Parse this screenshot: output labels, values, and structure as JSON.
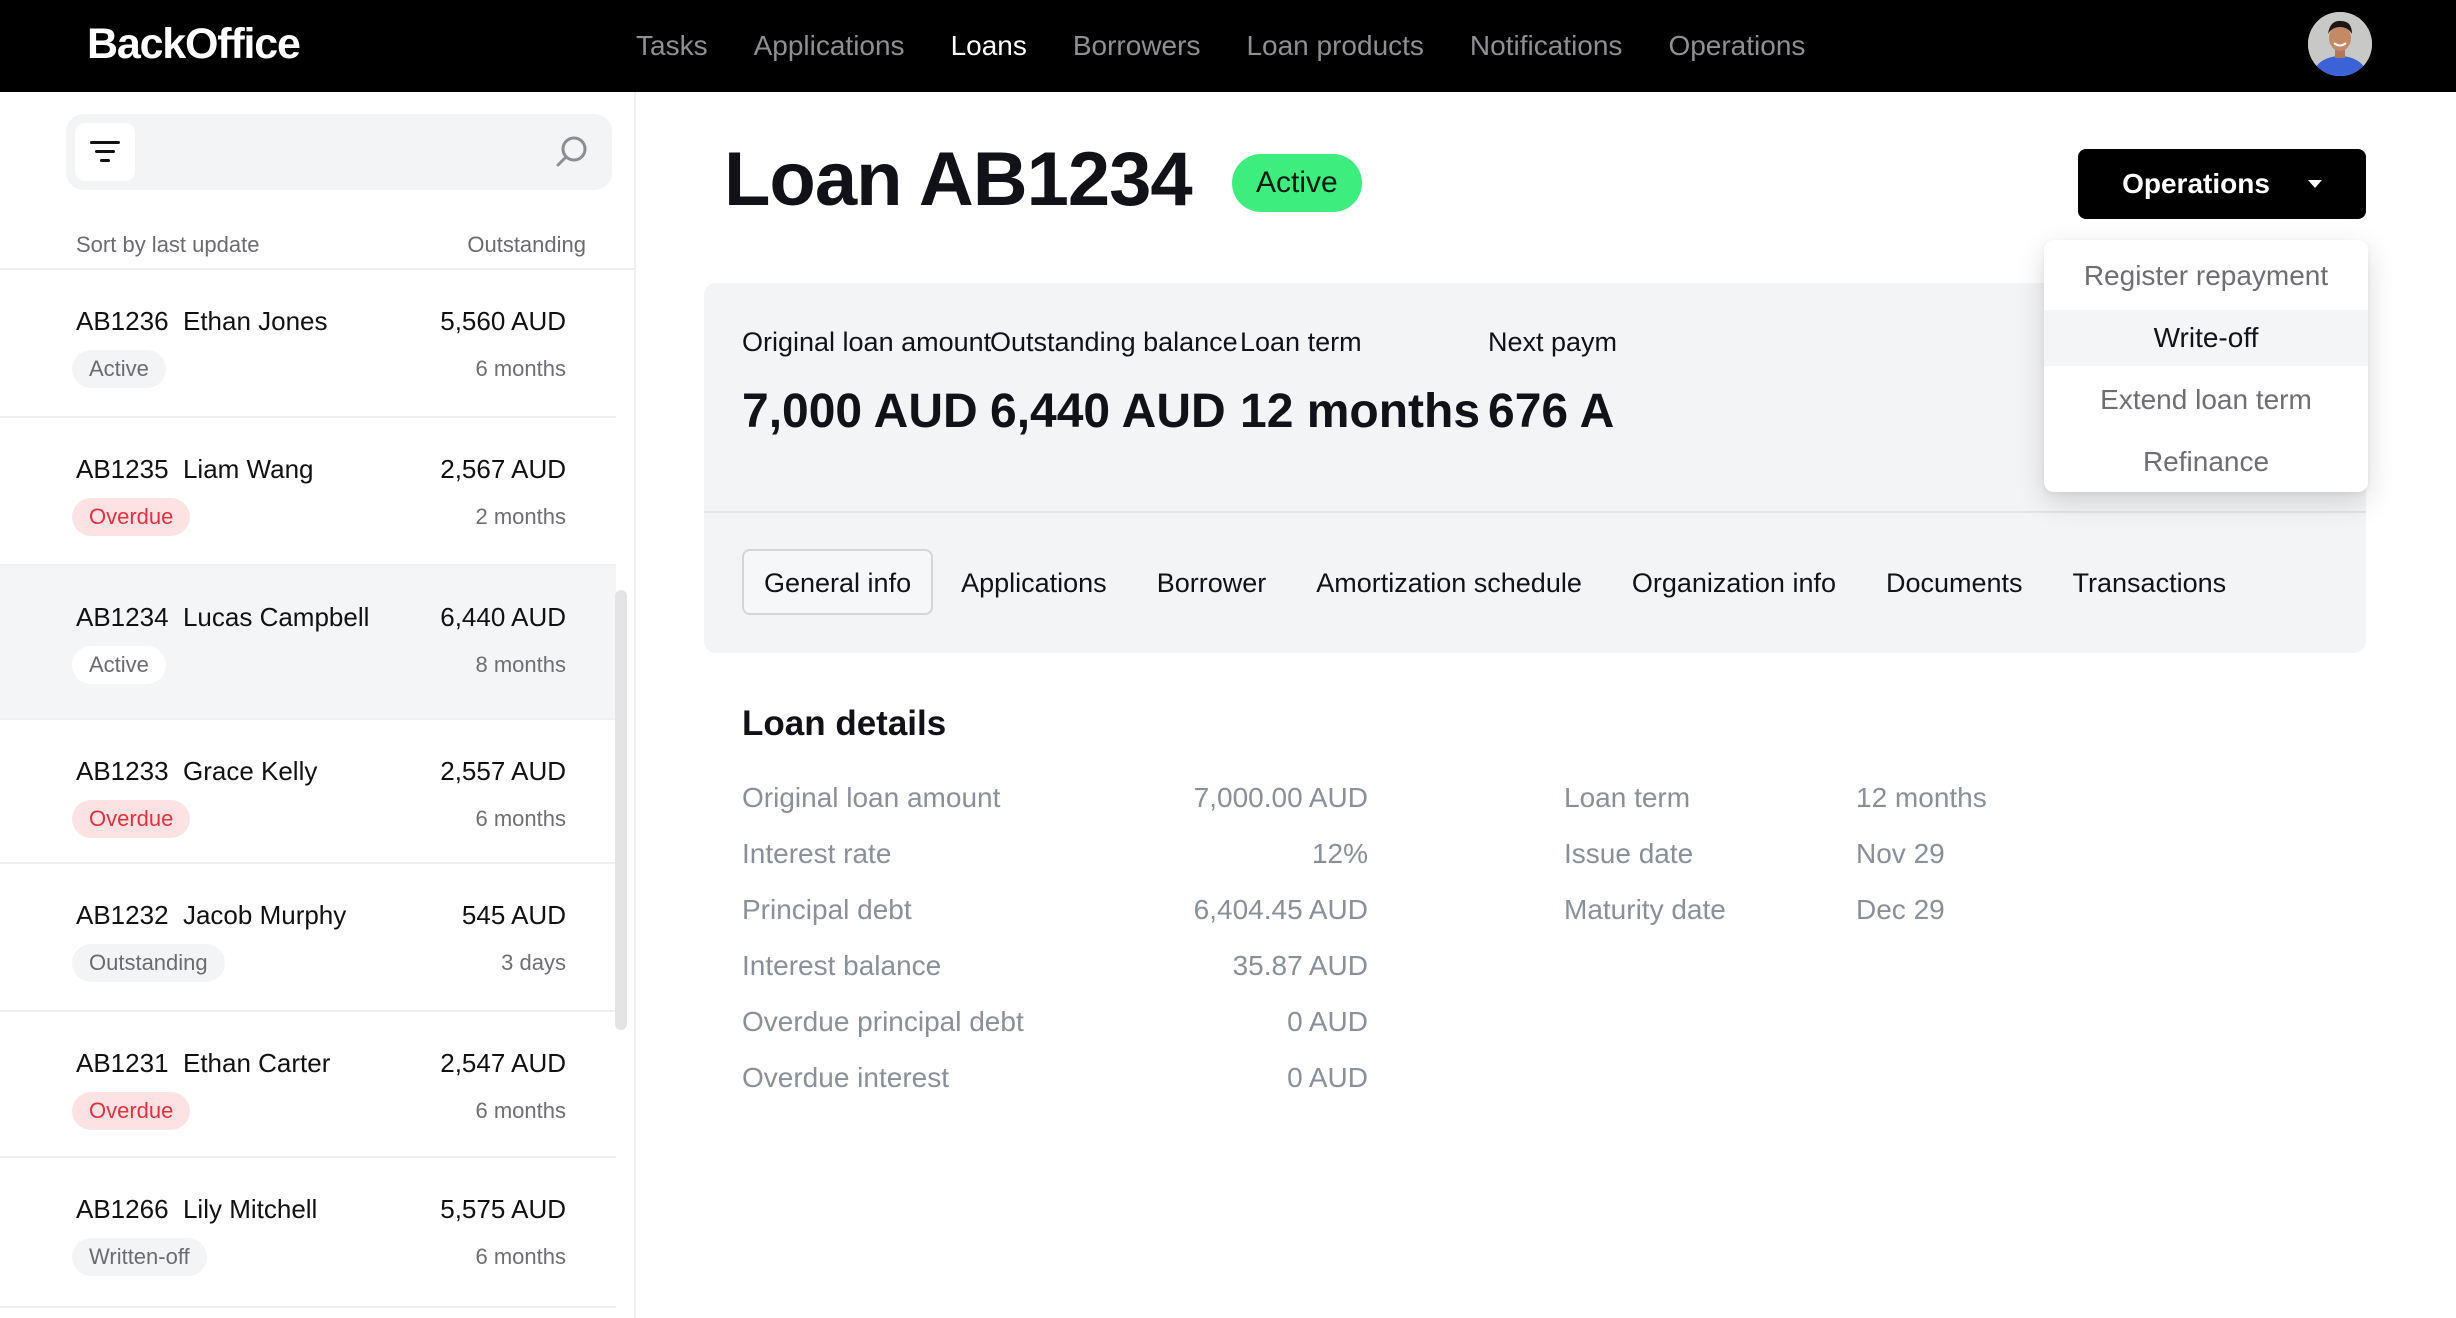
{
  "app": {
    "brand": "BackOffice"
  },
  "nav": {
    "items": [
      {
        "label": "Tasks",
        "active": false
      },
      {
        "label": "Applications",
        "active": false
      },
      {
        "label": "Loans",
        "active": true
      },
      {
        "label": "Borrowers",
        "active": false
      },
      {
        "label": "Loan products",
        "active": false
      },
      {
        "label": "Notifications",
        "active": false
      },
      {
        "label": "Operations",
        "active": false
      }
    ],
    "avatar_icon": "user-avatar"
  },
  "sidebar": {
    "search": {
      "placeholder": "",
      "value": "",
      "filter_icon": "filter-icon",
      "search_icon": "search-icon"
    },
    "sort_label": "Sort by last update",
    "column_label": "Outstanding",
    "loans": [
      {
        "id": "AB1236",
        "name": "Ethan Jones",
        "amount": "5,560 AUD",
        "status": "Active",
        "term": "6 months",
        "selected": false
      },
      {
        "id": "AB1235",
        "name": "Liam Wang",
        "amount": "2,567 AUD",
        "status": "Overdue",
        "term": "2 months",
        "selected": false
      },
      {
        "id": "AB1234",
        "name": "Lucas Campbell",
        "amount": "6,440 AUD",
        "status": "Active",
        "term": "8 months",
        "selected": true
      },
      {
        "id": "AB1233",
        "name": "Grace Kelly",
        "amount": "2,557 AUD",
        "status": "Overdue",
        "term": "6 months",
        "selected": false
      },
      {
        "id": "AB1232",
        "name": "Jacob Murphy",
        "amount": "545 AUD",
        "status": "Outstanding",
        "term": "3 days",
        "selected": false
      },
      {
        "id": "AB1231",
        "name": "Ethan Carter",
        "amount": "2,547 AUD",
        "status": "Overdue",
        "term": "6 months",
        "selected": false
      },
      {
        "id": "AB1266",
        "name": "Lily Mitchell",
        "amount": "5,575 AUD",
        "status": "Written-off",
        "term": "6 months",
        "selected": false
      }
    ]
  },
  "loan": {
    "title": "Loan AB1234",
    "status": "Active",
    "status_color": "#3ded7d",
    "operations_button": "Operations",
    "operations_menu": [
      {
        "label": "Register repayment",
        "hovered": false
      },
      {
        "label": "Write-off",
        "hovered": true
      },
      {
        "label": "Extend loan term",
        "hovered": false
      },
      {
        "label": "Refinance",
        "hovered": false
      }
    ],
    "summary": [
      {
        "label": "Original loan amount",
        "value": "7,000 AUD"
      },
      {
        "label": "Outstanding balance",
        "value": "6,440 AUD"
      },
      {
        "label": "Loan term",
        "value": "12 months"
      },
      {
        "label": "Next paym",
        "value": "676 A"
      }
    ],
    "tabs": [
      {
        "label": "General info",
        "active": true
      },
      {
        "label": "Applications",
        "active": false
      },
      {
        "label": "Borrower",
        "active": false
      },
      {
        "label": "Amortization schedule",
        "active": false
      },
      {
        "label": "Organization info",
        "active": false
      },
      {
        "label": "Documents",
        "active": false
      },
      {
        "label": "Transactions",
        "active": false
      }
    ],
    "details": {
      "title": "Loan details",
      "left": [
        {
          "key": "Original loan amount",
          "value": "7,000.00 AUD"
        },
        {
          "key": "Interest rate",
          "value": "12%"
        },
        {
          "key": "Principal debt",
          "value": "6,404.45 AUD"
        },
        {
          "key": "Interest balance",
          "value": "35.87 AUD"
        },
        {
          "key": "Overdue principal debt",
          "value": "0 AUD"
        },
        {
          "key": "Overdue interest",
          "value": "0 AUD"
        }
      ],
      "right": [
        {
          "key": "Loan term",
          "value": "12 months"
        },
        {
          "key": "Issue date",
          "value": "Nov 29"
        },
        {
          "key": "Maturity date",
          "value": "Dec 29"
        }
      ]
    }
  },
  "colors": {
    "overdue_text": "#e0323f",
    "overdue_bg": "#fde2e4",
    "neutral_badge_bg": "#f3f4f6",
    "topbar_bg": "#000000"
  }
}
